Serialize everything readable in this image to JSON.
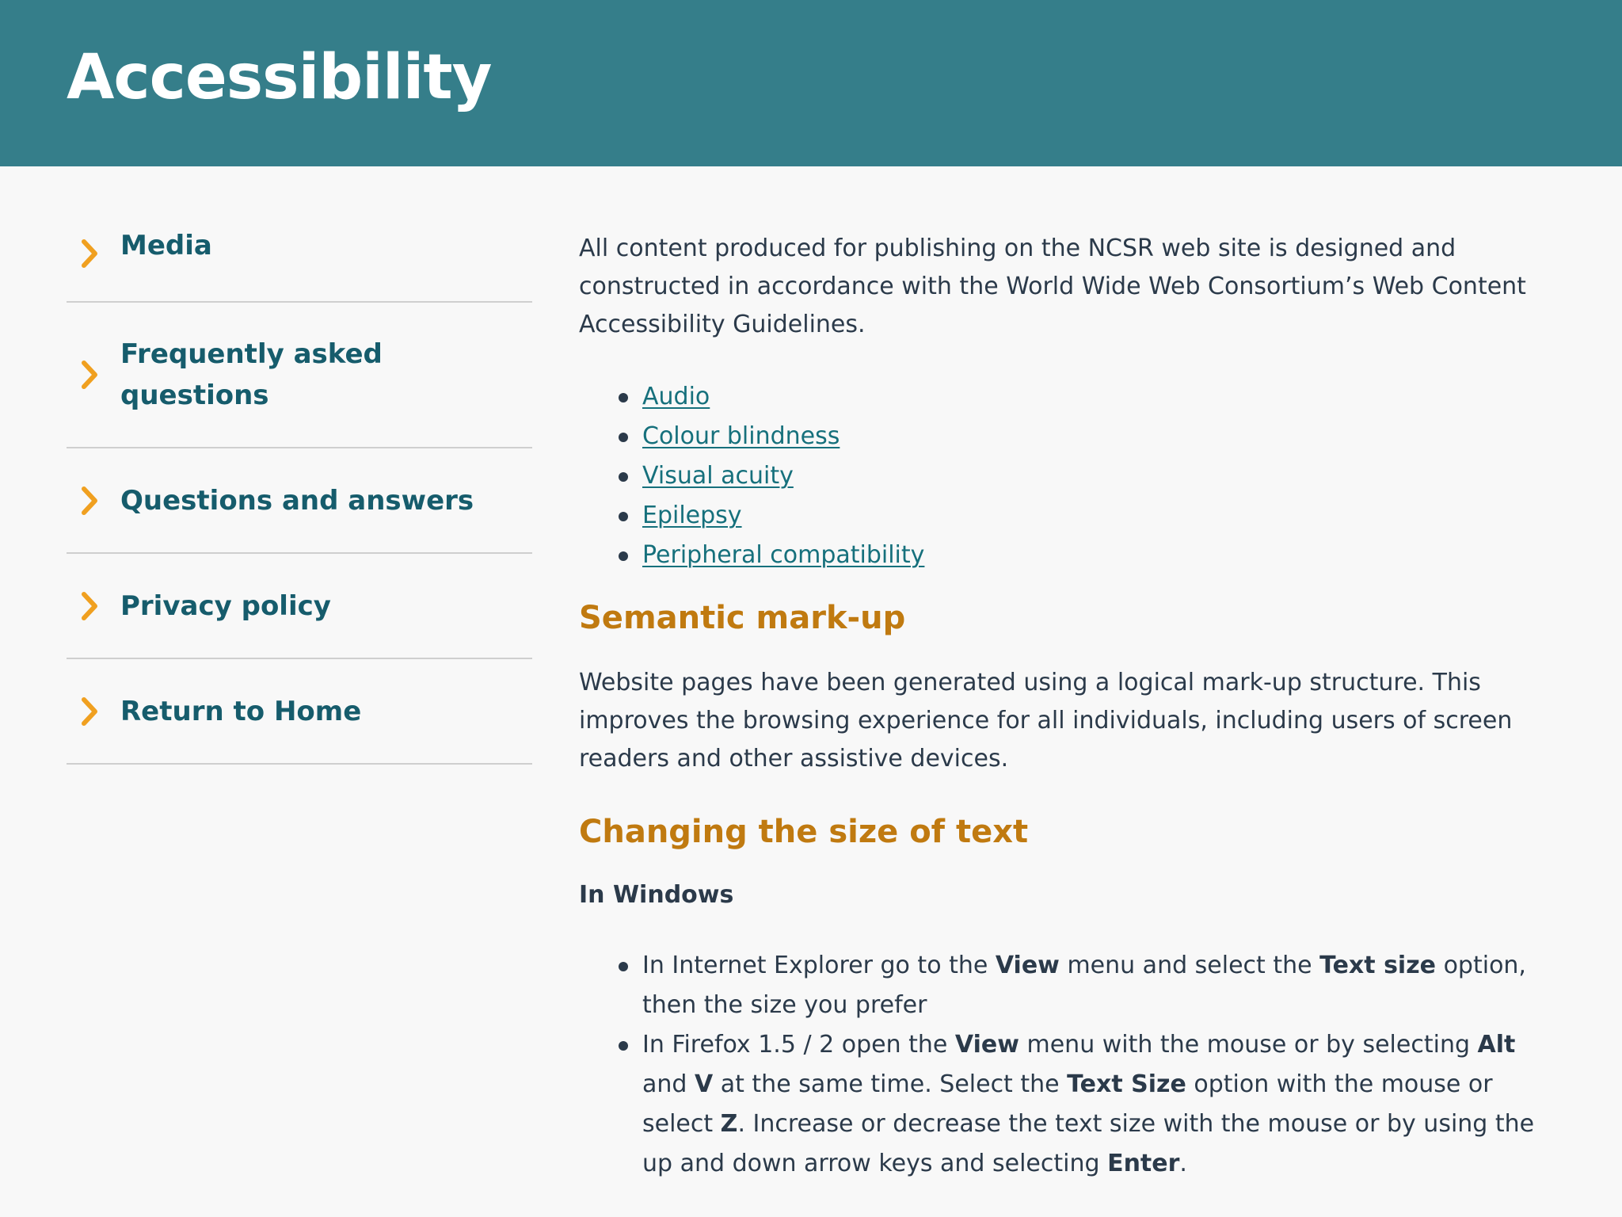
{
  "header": {
    "title": "Accessibility",
    "bg_color": "#357e8a"
  },
  "sidebar": {
    "items": [
      {
        "label": "Media"
      },
      {
        "label": "Frequently asked questions"
      },
      {
        "label": "Questions and answers"
      },
      {
        "label": "Privacy policy"
      },
      {
        "label": "Return to Home"
      }
    ],
    "chevron_icon": "chevron-right-icon",
    "chevron_color": "#f0a020",
    "label_color": "#165c6c"
  },
  "main": {
    "intro": "All content produced for publishing on the NCSR web site is designed and constructed in accordance with the World Wide Web Consortium’s Web Content Accessibility Guidelines.",
    "links": [
      "Audio",
      "Colour blindness",
      "Visual acuity",
      "Epilepsy",
      "Peripheral compatibility"
    ],
    "semantic_heading": "Semantic mark-up",
    "semantic_text": "Website pages have been generated using a logical mark-up structure. This improves the browsing experience for all individuals, including users of screen readers and other assistive devices.",
    "size_heading": "Changing the size of text",
    "windows_heading": "In Windows",
    "ie_item": {
      "t1": "In Internet Explorer go to the ",
      "b1": "View",
      "t2": " menu and select the ",
      "b2": "Text size",
      "t3": " option, then the size you prefer"
    },
    "ff_item": {
      "t1": "In Firefox 1.5 / 2 open the ",
      "b1": "View",
      "t2": " menu with the mouse or by selecting ",
      "b2": "Alt",
      "t3": " and ",
      "b3": "V",
      "t4": " at the same time. Select the ",
      "b4": "Text Size",
      "t5": " option with the mouse or select ",
      "b5": "Z",
      "t6": ". Increase or decrease the text size with the mouse or by using the up and down arrow keys and selecting ",
      "b6": "Enter",
      "t7": "."
    },
    "heading_color": "#c07a10",
    "link_color": "#16707c"
  }
}
